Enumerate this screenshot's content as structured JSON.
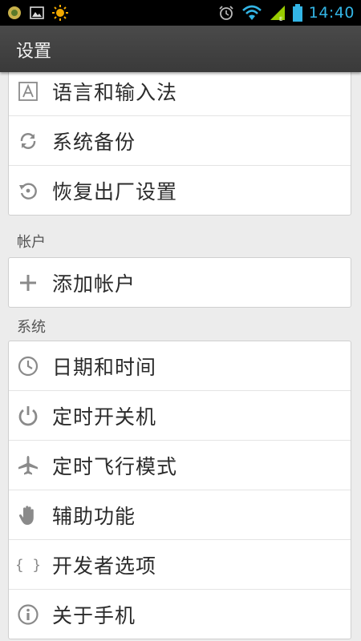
{
  "status_bar": {
    "time": "14:40",
    "icons_left": [
      "app-notification-icon",
      "image-icon",
      "sun-icon"
    ],
    "icons_right": [
      "alarm-icon",
      "wifi-icon",
      "signal-icon",
      "battery-icon"
    ]
  },
  "header": {
    "title": "设置"
  },
  "group_personal": {
    "items": [
      {
        "label": "语言和输入法",
        "icon": "language-icon"
      },
      {
        "label": "系统备份",
        "icon": "sync-icon"
      },
      {
        "label": "恢复出厂设置",
        "icon": "restore-icon"
      }
    ]
  },
  "accounts": {
    "header": "帐户",
    "items": [
      {
        "label": "添加帐户",
        "icon": "plus-icon"
      }
    ]
  },
  "system": {
    "header": "系统",
    "items": [
      {
        "label": "日期和时间",
        "icon": "clock-icon"
      },
      {
        "label": "定时开关机",
        "icon": "power-icon"
      },
      {
        "label": "定时飞行模式",
        "icon": "airplane-icon"
      },
      {
        "label": "辅助功能",
        "icon": "hand-icon"
      },
      {
        "label": "开发者选项",
        "icon": "braces-icon"
      },
      {
        "label": "关于手机",
        "icon": "info-icon"
      }
    ]
  },
  "colors": {
    "status_bar_bg": "#000000",
    "clock": "#33b5e5",
    "title_bar_bg": "#404040",
    "page_bg": "#ececec",
    "card_bg": "#ffffff",
    "icon_gray": "#8a8a8a"
  }
}
